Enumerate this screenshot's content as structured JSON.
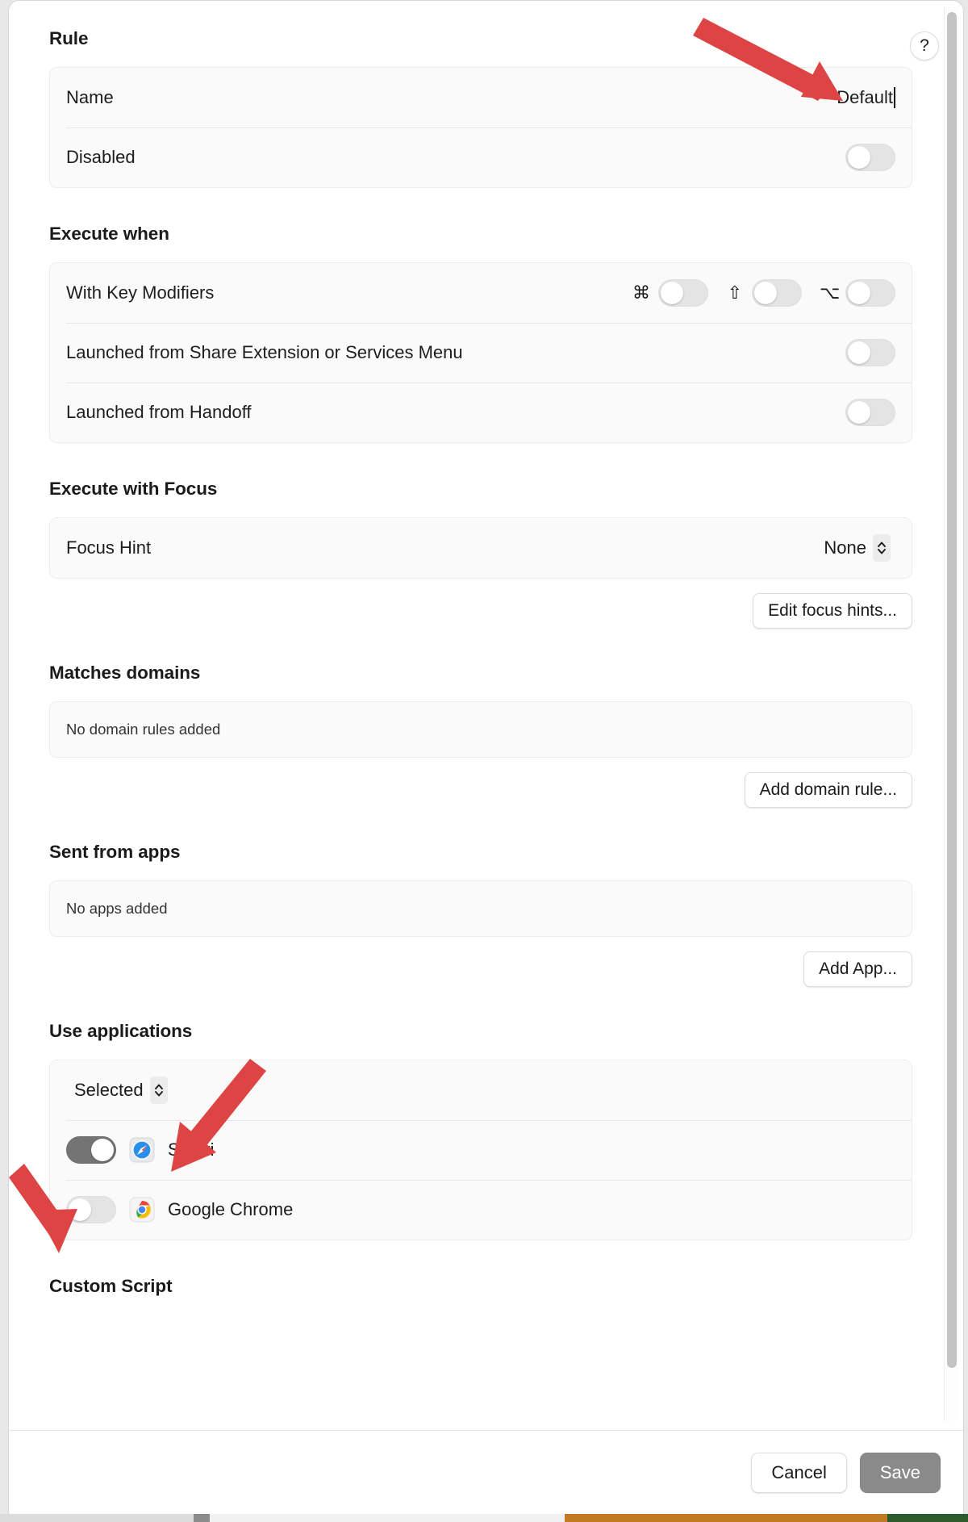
{
  "window": {
    "help_label": "?"
  },
  "rule": {
    "title": "Rule",
    "name_label": "Name",
    "name_value": "Default",
    "disabled_label": "Disabled",
    "disabled_on": false
  },
  "execute_when": {
    "title": "Execute when",
    "key_modifiers_label": "With Key Modifiers",
    "modifiers": [
      {
        "name": "command",
        "glyph": "⌘",
        "on": false
      },
      {
        "name": "shift",
        "glyph": "⇧",
        "on": false
      },
      {
        "name": "option",
        "glyph": "⌥",
        "on": false
      }
    ],
    "share_extension_label": "Launched from Share Extension or Services Menu",
    "share_extension_on": false,
    "handoff_label": "Launched from Handoff",
    "handoff_on": false
  },
  "execute_with_focus": {
    "title": "Execute with Focus",
    "focus_hint_label": "Focus Hint",
    "focus_hint_value": "None",
    "edit_focus_hints_label": "Edit focus hints..."
  },
  "matches_domains": {
    "title": "Matches domains",
    "empty_text": "No domain rules added",
    "add_button_label": "Add domain rule..."
  },
  "sent_from_apps": {
    "title": "Sent from apps",
    "empty_text": "No apps added",
    "add_button_label": "Add App..."
  },
  "use_applications": {
    "title": "Use applications",
    "mode_value": "Selected",
    "apps": [
      {
        "name": "Safari",
        "icon": "safari-icon",
        "on": true
      },
      {
        "name": "Google Chrome",
        "icon": "chrome-icon",
        "on": false
      }
    ]
  },
  "custom_script": {
    "title": "Custom Script"
  },
  "footer": {
    "cancel_label": "Cancel",
    "save_label": "Save"
  },
  "annotations": {
    "arrow_color": "#dd4545",
    "arrows": [
      {
        "name": "arrow-to-name-field",
        "target": "rule.name_value"
      },
      {
        "name": "arrow-to-selected-popup",
        "target": "use_applications.mode_value"
      },
      {
        "name": "arrow-to-safari-toggle",
        "target": "use_applications.apps.0"
      }
    ]
  }
}
